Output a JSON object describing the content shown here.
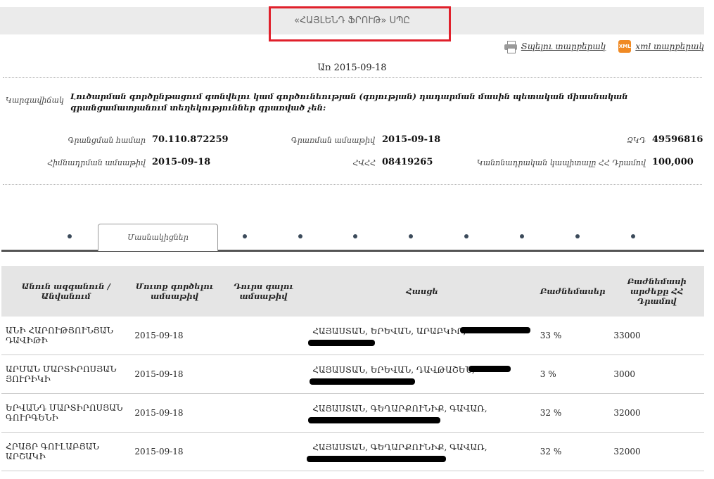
{
  "header": {
    "company_title": "«ՀԱՅԼԵՆԴ ՖՐՈՒԹ» ՍՊԸ",
    "print_label": "Տպելու տարբերակ",
    "xml_label": "xml տարբերակ",
    "xml_icon_text": "XML",
    "date_line": "Առ 2015-09-18"
  },
  "info": {
    "status_label": "Կարգավիճակ",
    "status_text": "Լուծարման գործընթացում գտնվելու կամ գործունեության (գոյության) դադարման մասին պետական միասնական գրանցամատյանում տեղեկություններ գրառված չեն:",
    "reg_number_label": "Գրանցման համար",
    "reg_number_value": "70.110.872259",
    "reg_date_label": "Գրառման ամսաթիվ",
    "reg_date_value": "2015-09-18",
    "tax_code_label": "ՁԿԴ",
    "tax_code_value": "49596816",
    "founding_date_label": "Հիմնադրման ամսաթիվ",
    "founding_date_value": "2015-09-18",
    "tin_label": "ՀՎՀՀ",
    "tin_value": "08419265",
    "capital_label": "Կանոնադրական կապիտալը ՀՀ Դրամով",
    "capital_value": "100,000"
  },
  "tabs": {
    "active_label": "Մասնակիցներ"
  },
  "table": {
    "headers": [
      "Անուն ազգանուն / Անվանում",
      "Մուտք գործելու ամսաթիվ",
      "Դուրս գալու ամսաթիվ",
      "Հասցե",
      "Բաժնեմասեր",
      "Բաժնեմասի արժեքը ՀՀ Դրամով"
    ],
    "rows": [
      {
        "name": "ԱՆԻ ՀԱՐՈՒԹՅՈՒՆՅԱՆ ԴԱՎԻԹԻ",
        "entry": "2015-09-18",
        "exit": "",
        "address": "ՀԱՅԱՍՏԱՆ, ԵՐԵՎԱՆ, ԱՐԱԲԿԻՐ,",
        "share": "33 %",
        "value": "33000"
      },
      {
        "name": "ԱՐՄԱՆ ՄԱՐՏԻՐՈՍՅԱՆ ՅՈՒՐԻԿԻ",
        "entry": "2015-09-18",
        "exit": "",
        "address": "ՀԱՅԱՍՏԱՆ, ԵՐԵՎԱՆ, ԴԱՎԹԱՇԵՆ,",
        "share": "3 %",
        "value": "3000"
      },
      {
        "name": "ԵՐՎԱՆԴ ՄԱՐՏԻՐՈՍՅԱՆ ԳՈՒՐԳԵՆԻ",
        "entry": "2015-09-18",
        "exit": "",
        "address": "ՀԱՅԱՍՏԱՆ, ԳԵՂԱՐՔՈՒՆԻՔ, ԳԱՎԱՌ,",
        "share": "32 %",
        "value": "32000"
      },
      {
        "name": "ՀՐԱՅՐ ԳՈՒԼԱԲՅԱՆ ԱՐՇԱԿԻ",
        "entry": "2015-09-18",
        "exit": "",
        "address": "ՀԱՅԱՍՏԱՆ, ԳԵՂԱՐՔՈՒՆԻՔ, ԳԱՎԱՌ,",
        "share": "32 %",
        "value": "32000"
      }
    ]
  },
  "colors": {
    "highlight_box": "#e0202b",
    "title_bar_bg": "#ebebeb",
    "table_header_bg": "#e5e5e5",
    "xml_icon": "#f08a24",
    "tab_dot": "#3b4a5a"
  }
}
